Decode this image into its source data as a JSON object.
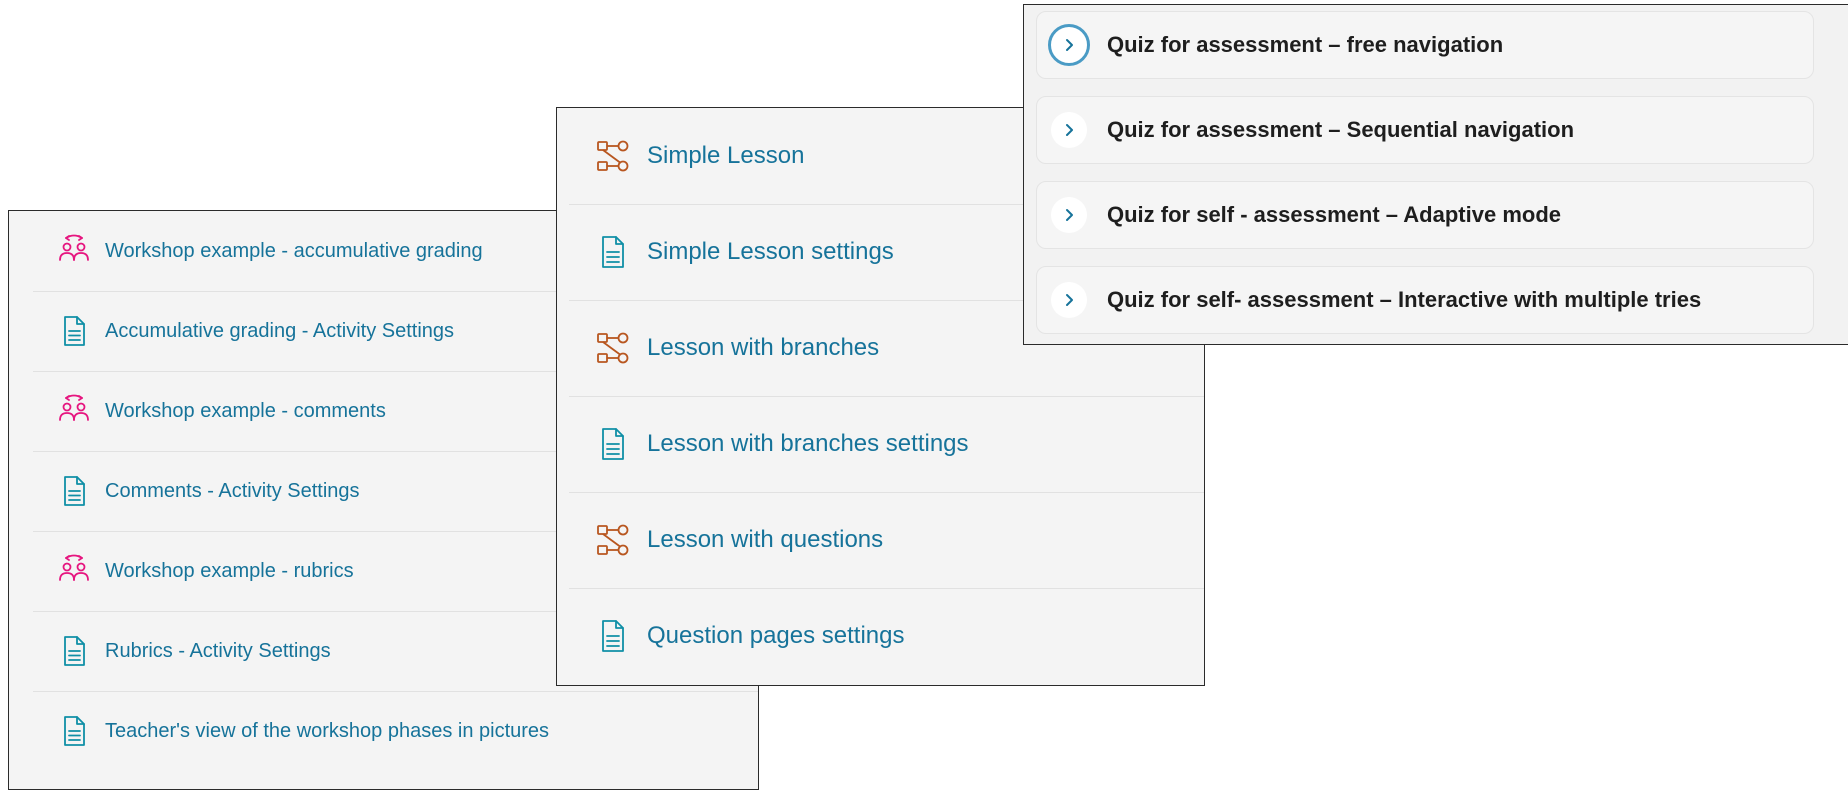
{
  "workshop_panel": {
    "items": [
      {
        "label": "Workshop example - accumulative grading",
        "icon": "workshop-icon"
      },
      {
        "label": "Accumulative grading - Activity Settings",
        "icon": "page-icon"
      },
      {
        "label": "Workshop example - comments",
        "icon": "workshop-icon"
      },
      {
        "label": "Comments - Activity Settings",
        "icon": "page-icon"
      },
      {
        "label": "Workshop example - rubrics",
        "icon": "workshop-icon"
      },
      {
        "label": "Rubrics - Activity Settings",
        "icon": "page-icon"
      },
      {
        "label": "Teacher's view of the workshop phases in pictures",
        "icon": "page-icon"
      }
    ]
  },
  "lessons_panel": {
    "items": [
      {
        "label": "Simple Lesson",
        "icon": "lesson-icon"
      },
      {
        "label": "Simple Lesson settings",
        "icon": "page-icon"
      },
      {
        "label": "Lesson with branches",
        "icon": "lesson-icon"
      },
      {
        "label": "Lesson with branches settings",
        "icon": "page-icon"
      },
      {
        "label": "Lesson with questions",
        "icon": "lesson-icon"
      },
      {
        "label": "Question pages settings",
        "icon": "page-icon"
      }
    ]
  },
  "quiz_panel": {
    "items": [
      {
        "label": "Quiz for assessment – free navigation",
        "icon": "chevron-right-icon",
        "focused": true
      },
      {
        "label": "Quiz for assessment – Sequential navigation",
        "icon": "chevron-right-icon"
      },
      {
        "label": "Quiz for self - assessment – Adaptive mode",
        "icon": "chevron-right-icon"
      },
      {
        "label": "Quiz for self- assessment – Interactive with multiple tries",
        "icon": "chevron-right-icon"
      }
    ]
  },
  "colors": {
    "link": "#16739a",
    "workshop_icon": "#e6157f",
    "page_icon": "#0f8fa6",
    "lesson_icon": "#b8561f",
    "focus_ring": "#4a9bc5"
  }
}
